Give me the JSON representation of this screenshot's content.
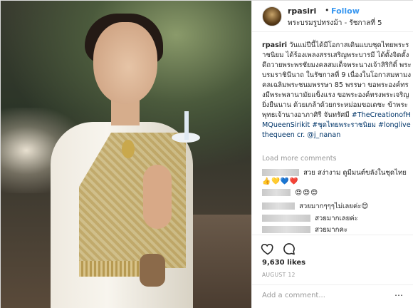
{
  "post": {
    "username": "rpasiri",
    "dot": "•",
    "follow_label": "Follow",
    "location": "พระบรมรูปทรงม้า - รัชกาลที่ 5",
    "caption_user": "rpasiri",
    "caption_text": "วันแม่ปีนี้ได้มีโอกาสเดินแบบชุดไทยพระราชนิยม ได้ร้องเพลงสรรเสริญพระบารมี ได้ตั้งจิตตั้งดีถวายพระพรชัยมงคลสมเด็จพระนางเจ้าสิริกิติ์ พระบรมราชินีนาถ ในรัชกาลที่ 9 เนื่องในโอกาสมหามงคลเฉลิมพระชนมพรรษา 85 พรรษา ขอพระองค์ทรงมีพระพลานามัยแข็งแรง ขอพระองค์ทรงพระเจริญยิ่งยืนนาน ด้วยเกล้าด้วยกระหม่อมขอเดชะ ข้าพระพุทธเจ้านางอาภาศิรี จันทรัศมี",
    "caption_tags": "#TheCreationofHMQueenSirikit #ชุดไทยพระราชนิยม #longlivethequeen cr. @j_nanan",
    "load_more": "Load more comments",
    "likes": "9,630 likes",
    "date": "AUGUST 12",
    "add_comment_placeholder": "Add a comment..."
  },
  "comments": [
    {
      "text": "สวย สง่างาม ดูมีมนต์ขลังในชุดไทย",
      "emoji": "👍💛💙❤️"
    },
    {
      "text": "",
      "emoji": "😍😍😍"
    },
    {
      "text": "สวยมากๆๆๆไม่เลยค่ะ😍",
      "emoji": ""
    },
    {
      "text": "สวยมากเลยค่ะ",
      "emoji": ""
    },
    {
      "text": "สวยมากคะ",
      "emoji": ""
    }
  ],
  "icons": {
    "like": "heart-icon",
    "comment": "speech-bubble-icon",
    "more": "ellipsis-icon"
  },
  "colors": {
    "accent": "#3897f0",
    "tag": "#003569",
    "text": "#262626",
    "muted": "#999999"
  }
}
